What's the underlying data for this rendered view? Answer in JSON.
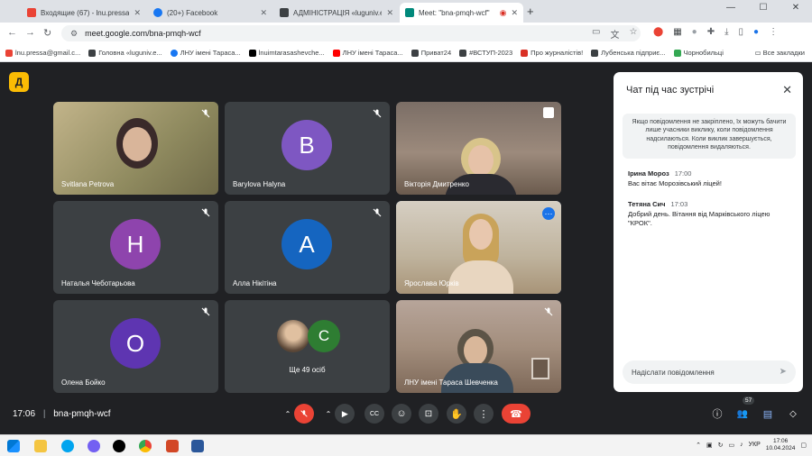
{
  "browser": {
    "tabs": [
      {
        "label": "Входящие (67) - lnu.pressa@gm",
        "favicon_color": "#ea4335"
      },
      {
        "label": "(20+) Facebook",
        "favicon_color": "#1877f2"
      },
      {
        "label": "АДМІНІСТРАЦІЯ «luguniv.edu",
        "favicon_color": "#3c4043"
      },
      {
        "label": "Meet: \"bna-pmqh-wcf\"",
        "favicon_color": "#00897b",
        "active": true
      }
    ],
    "new_tab": "+",
    "url": "meet.google.com/bna-pmqh-wcf",
    "bookmarks": [
      {
        "label": "lnu.pressa@gmail.c...",
        "color": "#ea4335"
      },
      {
        "label": "Головна «luguniv.e...",
        "color": "#3c4043"
      },
      {
        "label": "ЛНУ імені Тараса...",
        "color": "#1877f2"
      },
      {
        "label": "lnuimtarasashevche...",
        "color": "#000000"
      },
      {
        "label": "ЛНУ імені Тараса...",
        "color": "#ff0000"
      },
      {
        "label": "Приват24",
        "color": "#3c4043"
      },
      {
        "label": "#ВСТУП-2023",
        "color": "#3c4043"
      },
      {
        "label": "Про журналістів!",
        "color": "#d93025"
      },
      {
        "label": "Лубенська підприє...",
        "color": "#3c4043"
      },
      {
        "label": "Чорнобильці",
        "color": "#34a853"
      }
    ],
    "all_bookmarks": "Все закладки"
  },
  "meet": {
    "logo_letter": "Д",
    "tiles": [
      {
        "name": "Svitlana Petrova",
        "type": "video",
        "bg": "#a99a6b"
      },
      {
        "name": "Barylova Halyna",
        "type": "avatar",
        "letter": "B",
        "avatar_color": "#7e57c2"
      },
      {
        "name": "Вікторія Дмитренко",
        "type": "video",
        "bg": "#8d7a6a"
      },
      {
        "name": "Наталья Чеботарьова",
        "type": "avatar",
        "letter": "Н",
        "avatar_color": "#8e44ad"
      },
      {
        "name": "Алла Нікітіна",
        "type": "avatar",
        "letter": "А",
        "avatar_color": "#1565c0"
      },
      {
        "name": "Ярослава Юрків",
        "type": "video",
        "bg": "#c6b8a0",
        "active": true
      },
      {
        "name": "Олена Бойко",
        "type": "avatar",
        "letter": "О",
        "avatar_color": "#5e35b1"
      },
      {
        "name": "Ще 49 осіб",
        "type": "more",
        "letter": "C",
        "avatar_color": "#2e7d32"
      },
      {
        "name": "ЛНУ імені Тараса Шевченка",
        "type": "video",
        "bg": "#b59c88"
      }
    ],
    "meeting_time": "17:06",
    "meeting_code": "bna-pmqh-wcf",
    "participants_count": "57",
    "chat": {
      "title": "Чат під час зустрічі",
      "note": "Якщо повідомлення не закріплено, їх можуть бачити лише учасники виклику, коли повідомлення надсилаються. Коли виклик завершується, повідомлення видаляються.",
      "messages": [
        {
          "author": "Ірина Мороз",
          "time": "17:00",
          "text": "Вас вітає Морозівський ліцей!"
        },
        {
          "author": "Тетяна Сич",
          "time": "17:03",
          "text": "Добрий день. Вітання від Марківського ліцею \"КРОК\"."
        }
      ],
      "input_placeholder": "Надіслати повідомлення"
    }
  },
  "taskbar": {
    "lang": "УКР",
    "time": "17:06",
    "date": "10.04.2024"
  }
}
